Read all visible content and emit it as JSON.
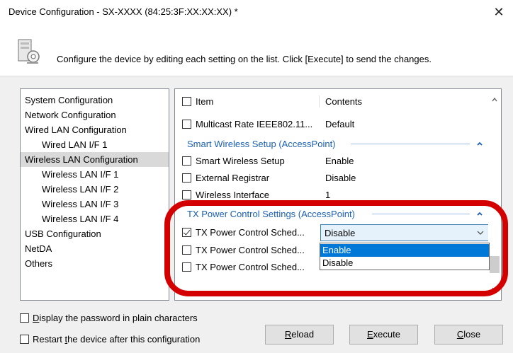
{
  "window": {
    "title": "Device Configuration - SX-XXXX (84:25:3F:XX:XX:XX) *",
    "close_glyph": "✕"
  },
  "header": {
    "icon": "device-settings-icon",
    "instruction": "Configure the device by editing each setting on the list. Click [Execute] to send the changes."
  },
  "tree": [
    {
      "label": "System Configuration",
      "selected": false
    },
    {
      "label": "Network Configuration",
      "selected": false
    },
    {
      "label": "Wired LAN Configuration",
      "selected": false
    },
    {
      "label": "Wired LAN I/F 1",
      "selected": false
    },
    {
      "label": "Wireless LAN Configuration",
      "selected": true
    },
    {
      "label": "Wireless LAN I/F 1",
      "selected": false
    },
    {
      "label": "Wireless LAN I/F 2",
      "selected": false
    },
    {
      "label": "Wireless LAN I/F 3",
      "selected": false
    },
    {
      "label": "Wireless LAN I/F 4",
      "selected": false
    },
    {
      "label": "USB Configuration",
      "selected": false
    },
    {
      "label": "NetDA",
      "selected": false
    },
    {
      "label": "Others",
      "selected": false
    }
  ],
  "list": {
    "header_item": "Item",
    "header_contents": "Contents",
    "rows": [
      {
        "item": "Multicast Rate IEEE802.11...",
        "contents": "Default",
        "checked": false
      },
      {
        "item": "Smart Wireless Setup",
        "contents": "Enable",
        "checked": false
      },
      {
        "item": "External Registrar",
        "contents": "Disable",
        "checked": false
      },
      {
        "item": "Wireless Interface",
        "contents": "1",
        "checked": false
      },
      {
        "item": "TX Power Control Sched...",
        "contents": "",
        "checked": true
      },
      {
        "item": "TX Power Control Sched...",
        "contents": "",
        "checked": false
      },
      {
        "item": "TX Power Control Sched...",
        "contents": "",
        "checked": false
      }
    ],
    "sections": [
      {
        "label": "Smart Wireless Setup (AccessPoint)"
      },
      {
        "label": "TX Power Control Settings (AccessPoint)"
      }
    ],
    "select_value": "Disable",
    "dropdown_options": [
      {
        "label": "Enable",
        "highlighted": true
      },
      {
        "label": "Disable",
        "highlighted": false
      }
    ]
  },
  "options": {
    "display_password_pre": "",
    "display_password_key": "D",
    "display_password_post": "isplay the password in plain characters",
    "restart_pre": "Restart ",
    "restart_key": "t",
    "restart_post": "he device after this configuration"
  },
  "buttons": {
    "reload_key": "R",
    "reload_rest": "eload",
    "execute_key": "E",
    "execute_rest": "xecute",
    "close_key": "C",
    "close_rest": "lose"
  },
  "colors": {
    "accent": "#0078d7",
    "section_text": "#1a5fb4",
    "highlight_ring": "#d40000"
  }
}
